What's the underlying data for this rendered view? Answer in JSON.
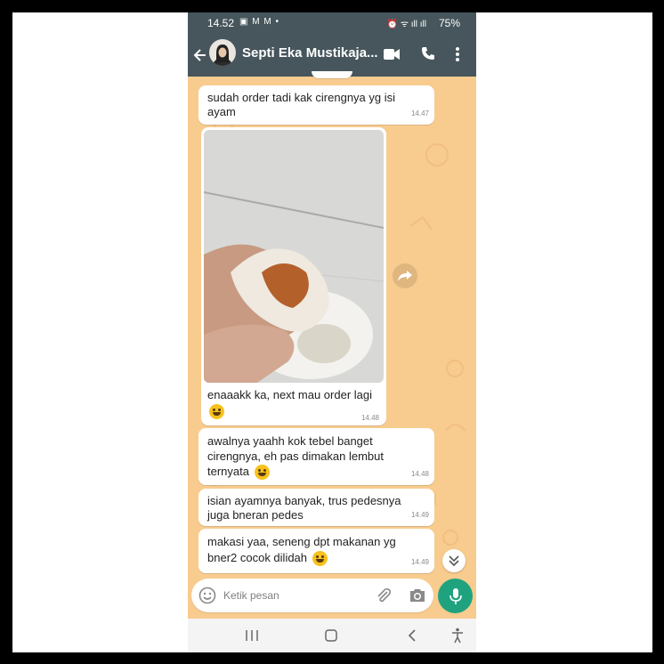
{
  "status_bar": {
    "time": "14.52",
    "battery": "75%",
    "icons": [
      "notification-icon",
      "mail-icon",
      "mail-icon",
      "dot-icon",
      "alarm-icon",
      "wifi-icon",
      "volte-signal-icon",
      "volte-signal-icon",
      "battery-icon"
    ]
  },
  "header": {
    "contact_name": "Septi Eka Mustikaja...",
    "icons": [
      "back-arrow-icon",
      "avatar",
      "video-call-icon",
      "phone-call-icon",
      "more-vert-icon"
    ]
  },
  "messages": [
    {
      "text": "sudah order tadi kak cirengnya yg isi ayam",
      "time": "14.47"
    },
    {
      "type": "image",
      "caption": "enaaakk ka, next mau order lagi",
      "emoji": "smiling-face",
      "time": "14.48"
    },
    {
      "text": "awalnya yaahh kok tebel banget cirengnya, eh pas dimakan lembut ternyata",
      "emoji": "face-with-hand-over-mouth",
      "time": "14.48"
    },
    {
      "text": "isian ayamnya banyak, trus pedesnya juga bneran pedes",
      "time": "14.49"
    },
    {
      "text": "makasi yaa, seneng dpt makanan yg bner2 cocok dilidah",
      "emoji": "grinning-face",
      "time": "14.49"
    }
  ],
  "input": {
    "placeholder": "Ketik pesan"
  },
  "colors": {
    "header": "#46565c",
    "wallpaper": "#f8cb8f",
    "bubble": "#ffffff",
    "mic_button": "#1fa37f"
  }
}
